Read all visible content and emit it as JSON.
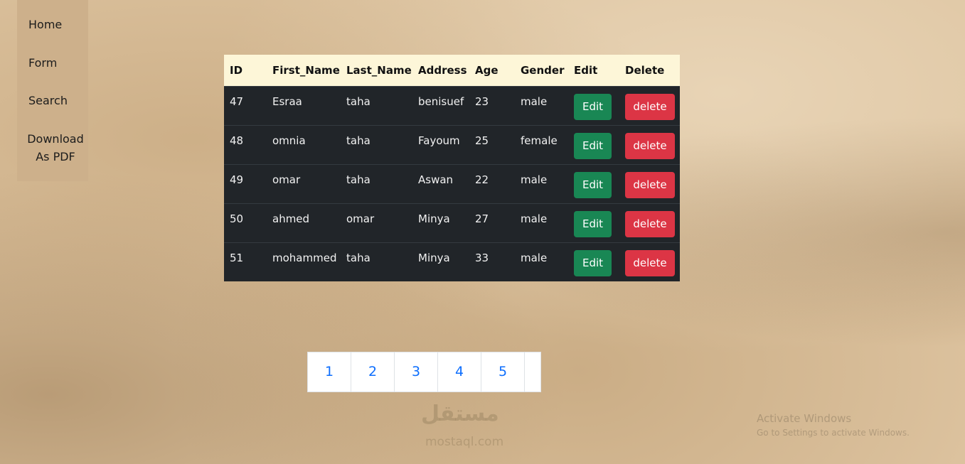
{
  "sidebar": {
    "items": [
      {
        "label": "Home"
      },
      {
        "label": "Form"
      },
      {
        "label": "Search"
      },
      {
        "label_line1": "Download",
        "label_line2": "As PDF"
      }
    ]
  },
  "table": {
    "headers": [
      "ID",
      "First_Name",
      "Last_Name",
      "Address",
      "Age",
      "Gender",
      "Edit",
      "Delete"
    ],
    "rows": [
      {
        "id": "47",
        "first": "Esraa",
        "last": "taha",
        "address": "benisuef",
        "age": "23",
        "gender": "male",
        "edit": "Edit",
        "delete": "delete"
      },
      {
        "id": "48",
        "first": "omnia",
        "last": "taha",
        "address": "Fayoum",
        "age": "25",
        "gender": "female",
        "edit": "Edit",
        "delete": "delete"
      },
      {
        "id": "49",
        "first": "omar",
        "last": "taha",
        "address": "Aswan",
        "age": "22",
        "gender": "male",
        "edit": "Edit",
        "delete": "delete"
      },
      {
        "id": "50",
        "first": "ahmed",
        "last": "omar",
        "address": "Minya",
        "age": "27",
        "gender": "male",
        "edit": "Edit",
        "delete": "delete"
      },
      {
        "id": "51",
        "first": "mohammed",
        "last": "taha",
        "address": "Minya",
        "age": "33",
        "gender": "male",
        "edit": "Edit",
        "delete": "delete"
      }
    ]
  },
  "pagination": {
    "pages": [
      "1",
      "2",
      "3",
      "4",
      "5"
    ]
  },
  "watermark": {
    "logo": "مستقل",
    "site": "mostaql.com"
  },
  "os_overlay": {
    "title": "Activate Windows",
    "subtitle": "Go to Settings to activate Windows."
  },
  "colors": {
    "edit_button": "#198754",
    "delete_button": "#dc3545",
    "table_header_bg": "#fdf6d8",
    "table_body_bg": "#212529",
    "sidebar_bg": "#cdb08b",
    "page_link": "#0d6efd"
  }
}
